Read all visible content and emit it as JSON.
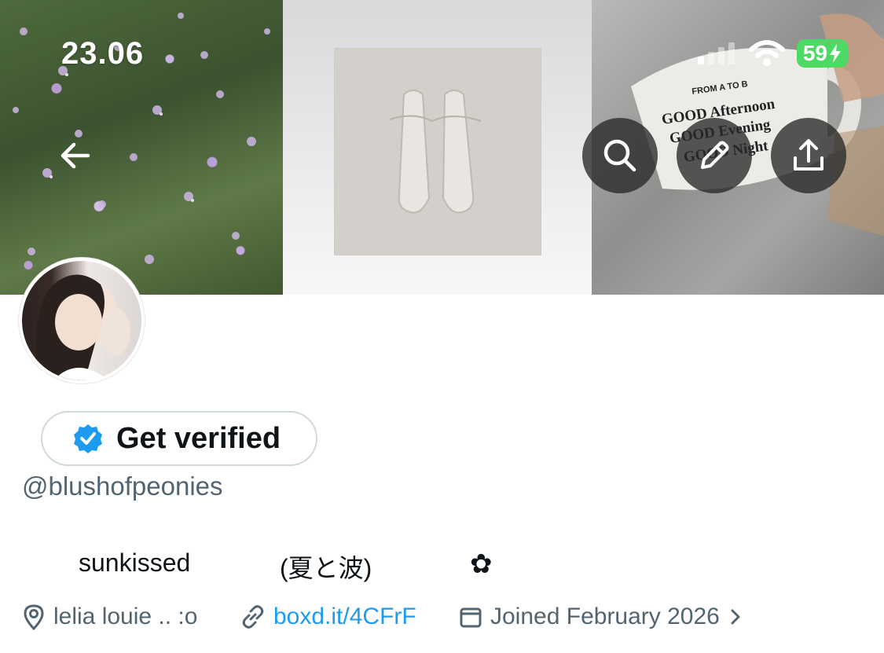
{
  "status_bar": {
    "time": "23.06",
    "battery": "59"
  },
  "header_images": {
    "left": "flowers",
    "middle": "ballet-shoes",
    "right": "mug",
    "mug_text": [
      "FROM A TO B",
      "GOOD Afternoon",
      "GOOD Evening",
      "GOOD Night"
    ]
  },
  "header_buttons": {
    "back": "back-arrow-icon",
    "search": "search-icon",
    "edit": "pencil-icon",
    "share": "share-icon"
  },
  "profile": {
    "verify_label": "Get verified",
    "handle": "@blushofpeonies",
    "bio": [
      "sunkissed",
      "(夏と波)",
      "✿"
    ],
    "location": "lelia louie .. :o",
    "link": "boxd.it/4CFrF",
    "joined": "Joined February 2026"
  },
  "colors": {
    "link": "#1d9bf0",
    "secondary_text": "#536471",
    "verified_badge": "#1d9bf0",
    "battery": "#4cd964"
  }
}
